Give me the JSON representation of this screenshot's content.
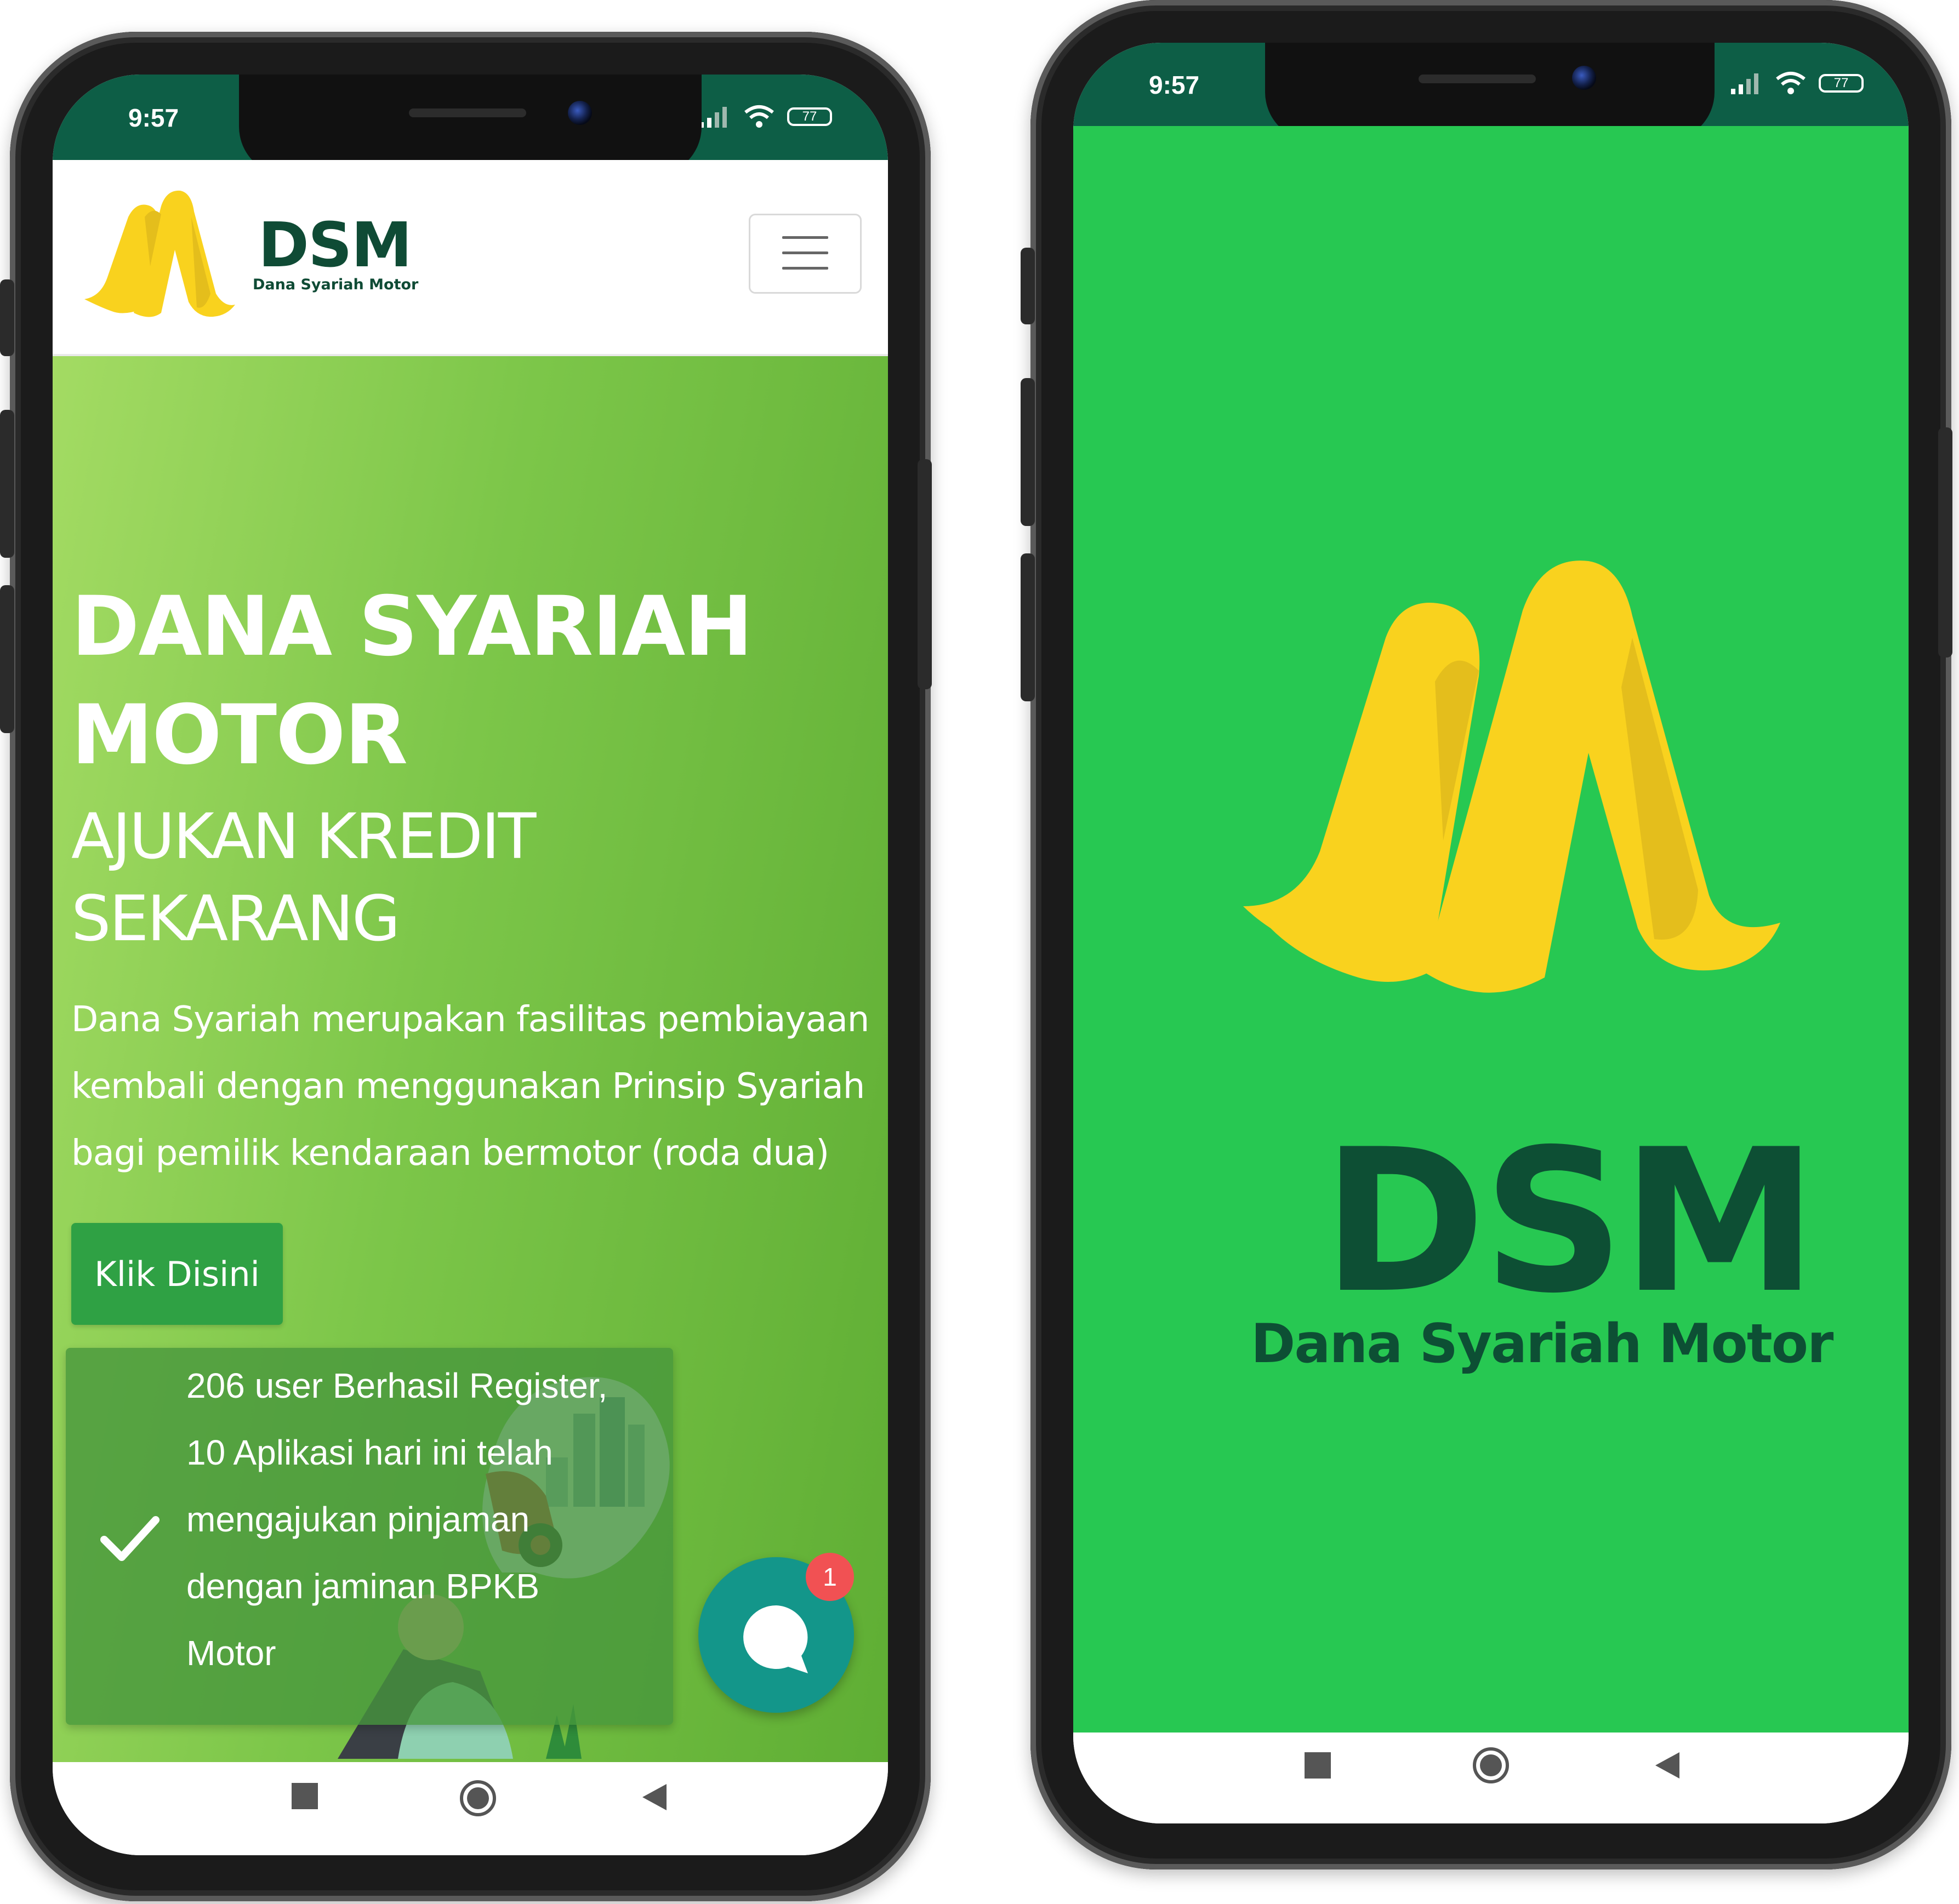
{
  "left_phone": {
    "status_time": "9:57",
    "battery": "77",
    "brand": {
      "title": "DSM",
      "subtitle": "Dana Syariah Motor"
    },
    "hero": {
      "title_line1": "DANA SYARIAH",
      "title_line2": "MOTOR",
      "subtitle_line1": "AJUKAN KREDIT",
      "subtitle_line2": "SEKARANG",
      "desc_line1": "Dana Syariah merupakan fasilitas pembiayaan",
      "desc_line2": "kembali dengan menggunakan Prinsip Syariah",
      "desc_line3": "bagi pemilik kendaraan bermotor (roda dua)",
      "cta_label": "Klik Disini"
    },
    "notification": {
      "line1": "206 user Berhasil Register,",
      "line2": "10 Aplikasi hari ini telah",
      "line3": "mengajukan pinjaman",
      "line4": "dengan jaminan BPKB",
      "line5": "Motor"
    },
    "chat_badge": "1"
  },
  "right_phone": {
    "status_time": "9:57",
    "battery": "77",
    "splash": {
      "title": "DSM",
      "subtitle": "Dana Syariah Motor"
    }
  },
  "colors": {
    "status_bar": "#0d5e46",
    "brand_dark_green": "#0f4b35",
    "logo_yellow": "#f9d21e",
    "logo_yellow_shadow": "#e4be1c",
    "hero_green_light": "#a3db63",
    "hero_green_dark": "#5fae34",
    "button_green": "#2fa144",
    "splash_green": "#27c852",
    "chat_teal": "#13968a",
    "badge_red": "#f15153"
  }
}
